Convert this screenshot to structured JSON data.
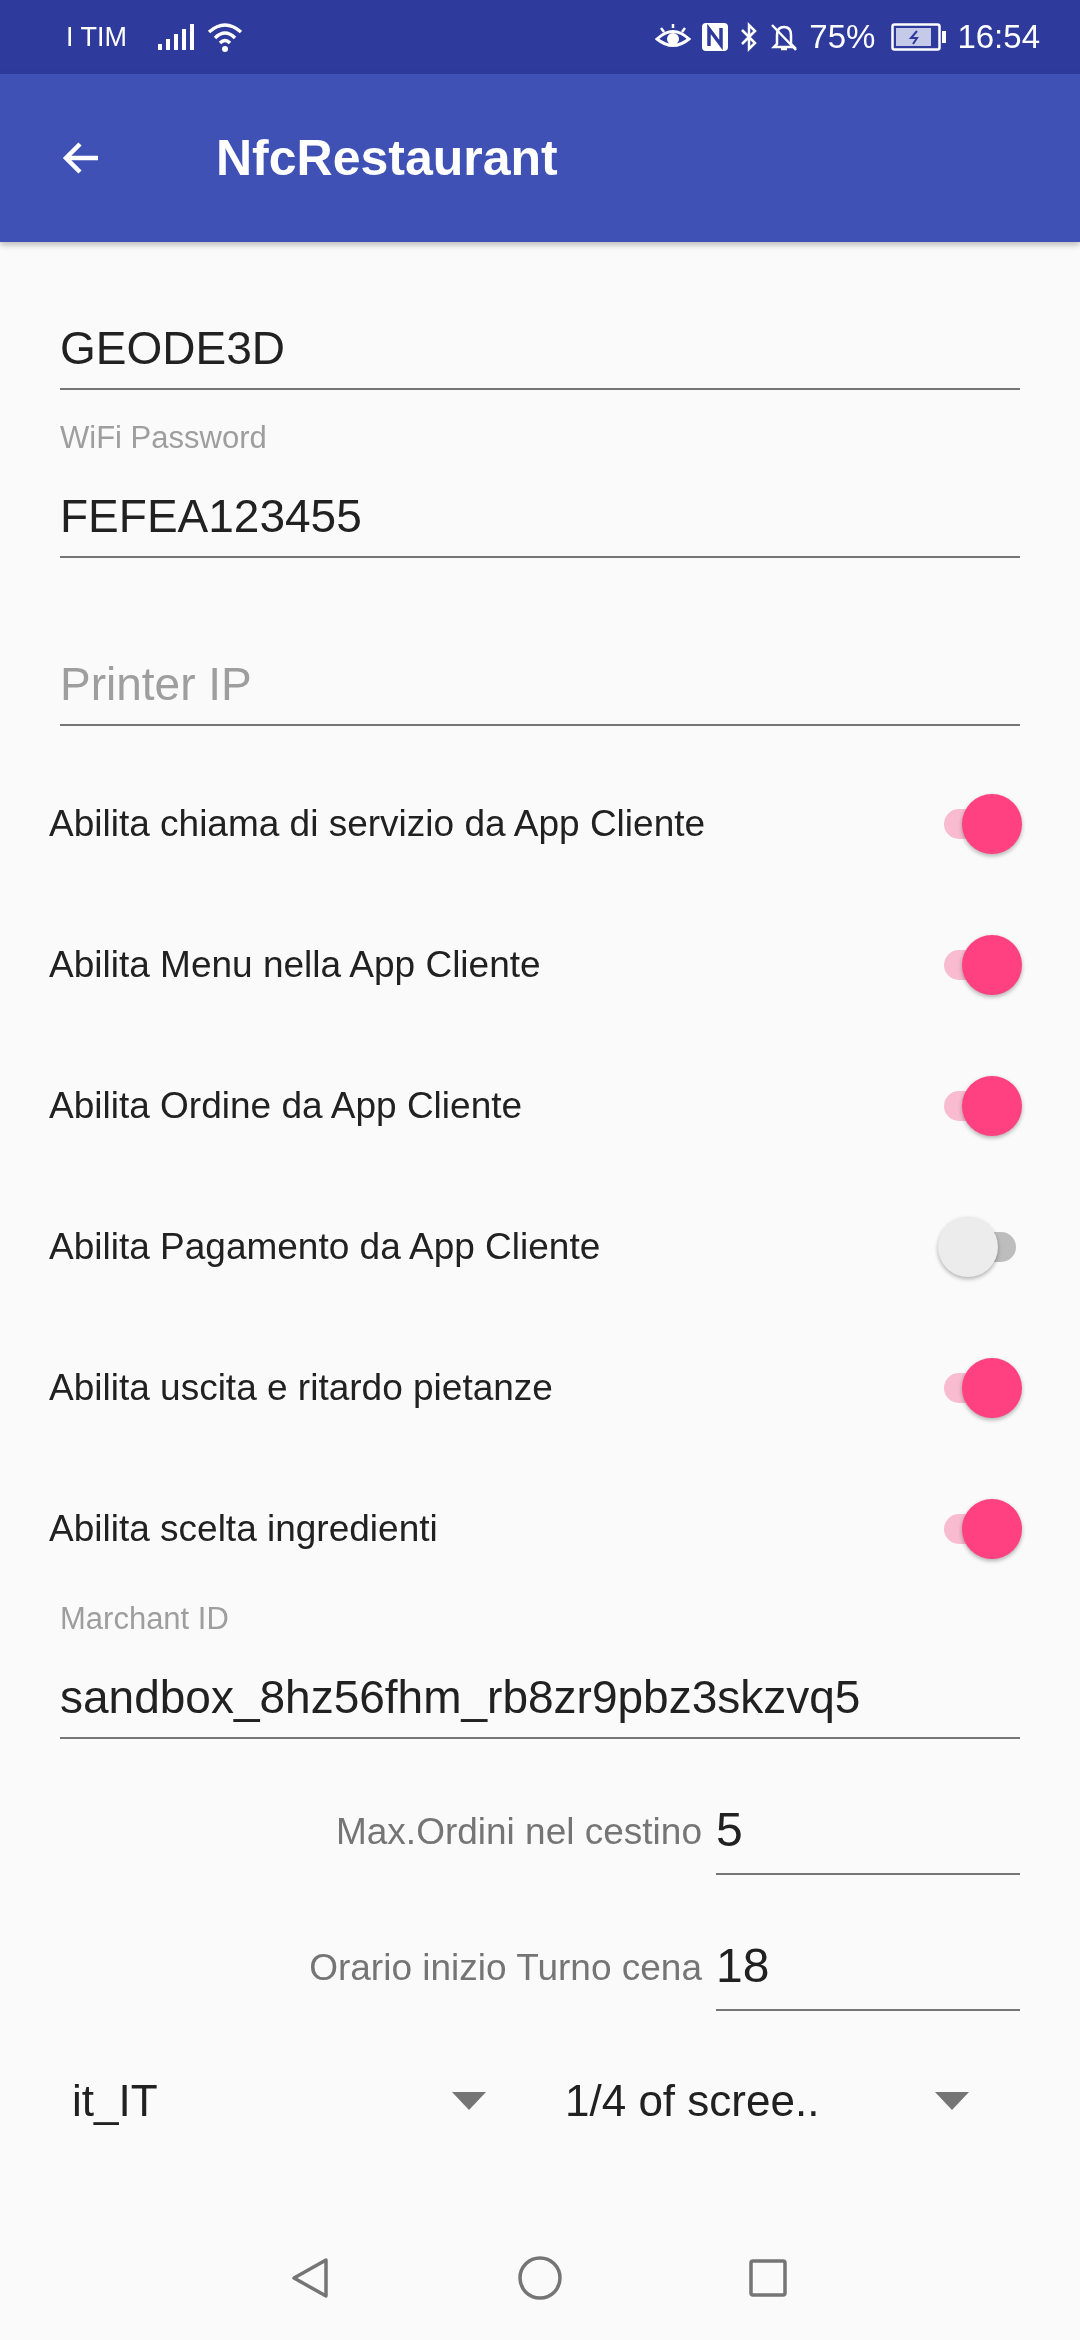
{
  "status_bar": {
    "carrier": "I TIM",
    "battery": "75%",
    "time": "16:54"
  },
  "app_bar": {
    "title": "NfcRestaurant"
  },
  "text_fields": [
    {
      "value": "GEODE3D"
    },
    {
      "label": "WiFi Password",
      "value": "FEFEA123455"
    },
    {
      "placeholder": "Printer IP"
    }
  ],
  "switches": [
    {
      "label": "Abilita chiama di servizio da App Cliente",
      "on": true
    },
    {
      "label": "Abilita Menu nella App Cliente",
      "on": true
    },
    {
      "label": "Abilita Ordine da App Cliente",
      "on": true
    },
    {
      "label": "Abilita Pagamento da App Cliente",
      "on": false
    },
    {
      "label": "Abilita uscita e ritardo pietanze",
      "on": true
    },
    {
      "label": "Abilita scelta ingredienti",
      "on": true
    }
  ],
  "merchant_field": {
    "label": "Marchant ID",
    "value": "sandbox_8hz56fhm_rb8zr9pbz3skzvq5"
  },
  "inline_fields": [
    {
      "label": "Max.Ordini nel cestino",
      "value": "5"
    },
    {
      "label": "Orario inizio Turno cena",
      "value": "18"
    }
  ],
  "spinners": [
    {
      "value": "it_IT"
    },
    {
      "value": "1/4 of scree.."
    }
  ]
}
